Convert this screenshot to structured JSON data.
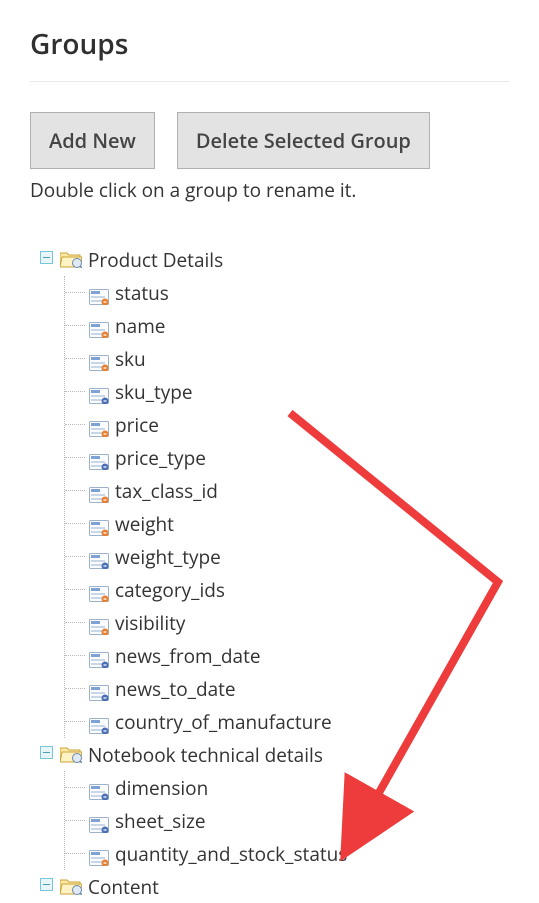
{
  "page": {
    "title": "Groups"
  },
  "toolbar": {
    "addNew": "Add New",
    "deleteSelected": "Delete Selected Group"
  },
  "instruction": "Double click on a group to rename it.",
  "tree": [
    {
      "label": "Product Details",
      "children": [
        {
          "label": "status",
          "variant": "orange"
        },
        {
          "label": "name",
          "variant": "orange"
        },
        {
          "label": "sku",
          "variant": "orange"
        },
        {
          "label": "sku_type",
          "variant": "blue"
        },
        {
          "label": "price",
          "variant": "orange"
        },
        {
          "label": "price_type",
          "variant": "blue"
        },
        {
          "label": "tax_class_id",
          "variant": "orange"
        },
        {
          "label": "weight",
          "variant": "orange"
        },
        {
          "label": "weight_type",
          "variant": "blue"
        },
        {
          "label": "category_ids",
          "variant": "orange"
        },
        {
          "label": "visibility",
          "variant": "orange"
        },
        {
          "label": "news_from_date",
          "variant": "blue"
        },
        {
          "label": "news_to_date",
          "variant": "blue"
        },
        {
          "label": "country_of_manufacture",
          "variant": "blue"
        }
      ]
    },
    {
      "label": "Notebook technical details",
      "children": [
        {
          "label": "dimension",
          "variant": "blue"
        },
        {
          "label": "sheet_size",
          "variant": "blue"
        },
        {
          "label": "quantity_and_stock_status",
          "variant": "orange"
        }
      ]
    },
    {
      "label": "Content",
      "children": []
    }
  ]
}
